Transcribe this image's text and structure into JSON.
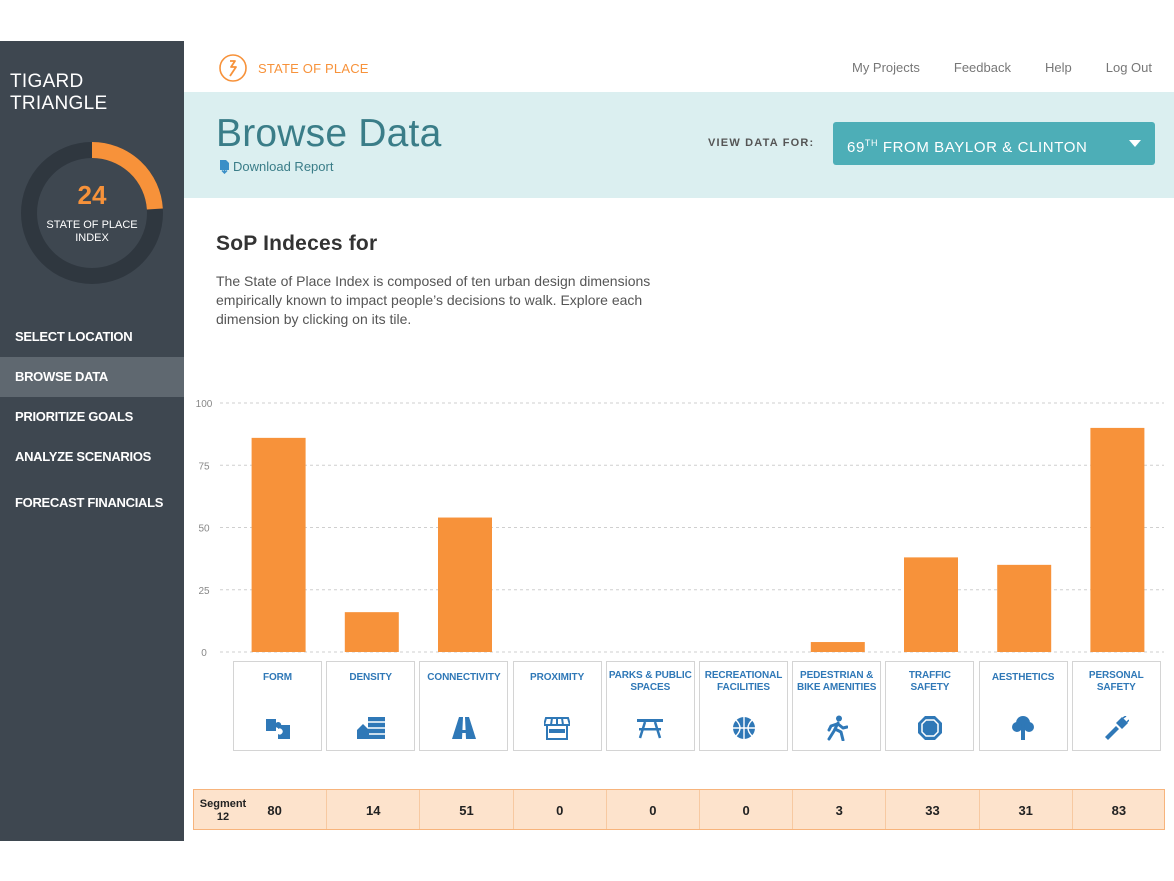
{
  "sidebar": {
    "title": "TIGARD TRIANGLE",
    "index": {
      "value": "24",
      "label": "STATE OF PLACE INDEX",
      "fraction": 0.24
    },
    "nav": [
      {
        "label": "SELECT LOCATION",
        "active": false
      },
      {
        "label": "BROWSE DATA",
        "active": true
      },
      {
        "label": "PRIORITIZE GOALS",
        "active": false
      },
      {
        "label": "ANALYZE SCENARIOS",
        "active": false
      },
      {
        "label": "FORECAST FINANCIALS",
        "active": false
      }
    ]
  },
  "topbar": {
    "brand": "STATE OF PLACE",
    "links": [
      "My Projects",
      "Feedback",
      "Help",
      "Log Out"
    ]
  },
  "header": {
    "title": "Browse Data",
    "download_label": "Download Report",
    "view_label": "VIEW DATA FOR:",
    "dropdown": {
      "prefix": "69",
      "sup": "TH",
      "rest": " FROM BAYLOR & CLINTON"
    }
  },
  "intro": {
    "title": "SoP Indeces for",
    "text": "The State of Place Index is composed of ten urban design dimensions empirically known to impact people’s decisions to walk. Explore each dimension by clicking on its tile."
  },
  "colors": {
    "accent": "#f7923a",
    "teal": "#4daeb7",
    "sidebar": "#3e4750",
    "tile_text": "#2f78b7"
  },
  "chart_data": {
    "type": "bar",
    "categories": [
      "FORM",
      "DENSITY",
      "CONNECTIVITY",
      "PROXIMITY",
      "PARKS & PUBLIC SPACES",
      "RECREATIONAL FACILITIES",
      "PEDESTRIAN & BIKE AMENITIES",
      "TRAFFIC SAFETY",
      "AESTHETICS",
      "PERSONAL SAFETY"
    ],
    "values": [
      86,
      16,
      54,
      0,
      0,
      0,
      4,
      38,
      35,
      90
    ],
    "ylim": [
      0,
      100
    ],
    "yticks": [
      "0",
      "25",
      "50",
      "75",
      "100"
    ],
    "grid": true
  },
  "tiles": [
    {
      "label": "FORM",
      "icon": "puzzle-icon"
    },
    {
      "label": "DENSITY",
      "icon": "buildings-icon"
    },
    {
      "label": "CONNECTIVITY",
      "icon": "road-icon"
    },
    {
      "label": "PROXIMITY",
      "icon": "storefront-icon"
    },
    {
      "label": "PARKS & PUBLIC SPACES",
      "icon": "picnic-table-icon"
    },
    {
      "label": "RECREATIONAL FACILITIES",
      "icon": "basketball-icon"
    },
    {
      "label": "PEDESTRIAN & BIKE AMENITIES",
      "icon": "walking-person-icon"
    },
    {
      "label": "TRAFFIC SAFETY",
      "icon": "stop-sign-icon"
    },
    {
      "label": "AESTHETICS",
      "icon": "tree-icon"
    },
    {
      "label": "PERSONAL SAFETY",
      "icon": "flashlight-icon"
    }
  ],
  "segment": {
    "label": "Segment 12",
    "values": [
      "80",
      "14",
      "51",
      "0",
      "0",
      "0",
      "3",
      "33",
      "31",
      "83"
    ]
  }
}
